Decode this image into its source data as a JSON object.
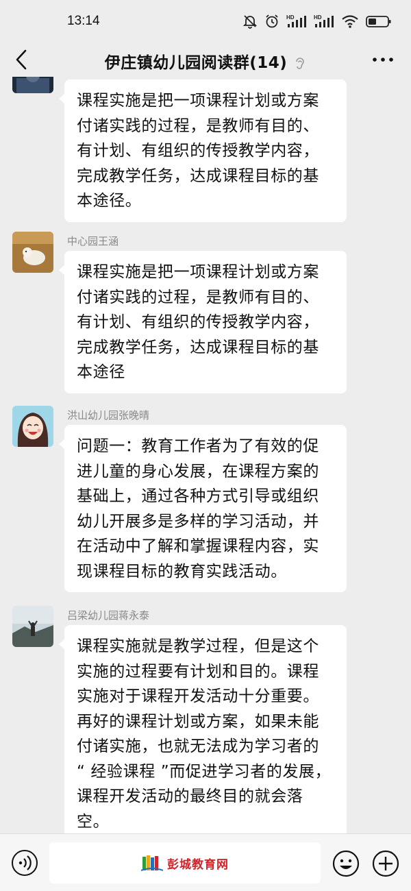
{
  "status_bar": {
    "time": "13:14",
    "icons": [
      "mute-bell-icon",
      "alarm-icon",
      "hd-signal-icon",
      "hd-signal-icon",
      "wifi-icon",
      "battery-icon"
    ]
  },
  "nav": {
    "title": "伊庄镇幼儿园阅读群(14)",
    "back_icon": "chevron-left-icon",
    "ear_icon": "ear-icon",
    "more_icon": "more-icon"
  },
  "messages": [
    {
      "sender": "",
      "lines": [
        "课程实施是把一项课程计划或方案",
        "付诸实践的过程，是教师有目的、",
        "有计划、有组织的传授教学内容，",
        "完成教学任务，达成课程目标的基",
        "本途径。"
      ]
    },
    {
      "sender": "中心园王涵",
      "lines": [
        "课程实施是把一项课程计划或方案",
        "付诸实践的过程，是教师有目的、",
        "有计划、有组织的传授教学内容，",
        "完成教学任务，达成课程目标的基",
        "本途径"
      ]
    },
    {
      "sender": "洪山幼儿园张晚晴",
      "lines": [
        "问题一：教育工作者为了有效的促",
        "进儿童的身心发展，在课程方案的",
        "基础上，通过各种方式引导或组织",
        "幼儿开展多是多样的学习活动，并",
        "在活动中了解和掌握课程内容，实",
        "现课程目标的教育实践活动。"
      ]
    },
    {
      "sender": "吕梁幼儿园蒋永泰",
      "lines": [
        "课程实施就是教学过程，但是这个",
        "实施的过程要有计划和目的。课程",
        "实施对于课程开发活动十分重要。",
        "再好的课程计划或方案，如果未能",
        "付诸实施，也就无法成为学习者的",
        "“ 经验课程 ”而促进学习者的发展，",
        "课程开发活动的最终目的就会落",
        "空。"
      ]
    }
  ],
  "input_bar": {
    "voice_icon": "voice-icon",
    "watermark_text": "彭城教育网",
    "emoji_icon": "emoji-icon",
    "plus_icon": "plus-icon"
  },
  "colors": {
    "background": "#ededed",
    "bubble": "#ffffff",
    "sender_name": "#888888",
    "watermark": "#d2232a"
  }
}
